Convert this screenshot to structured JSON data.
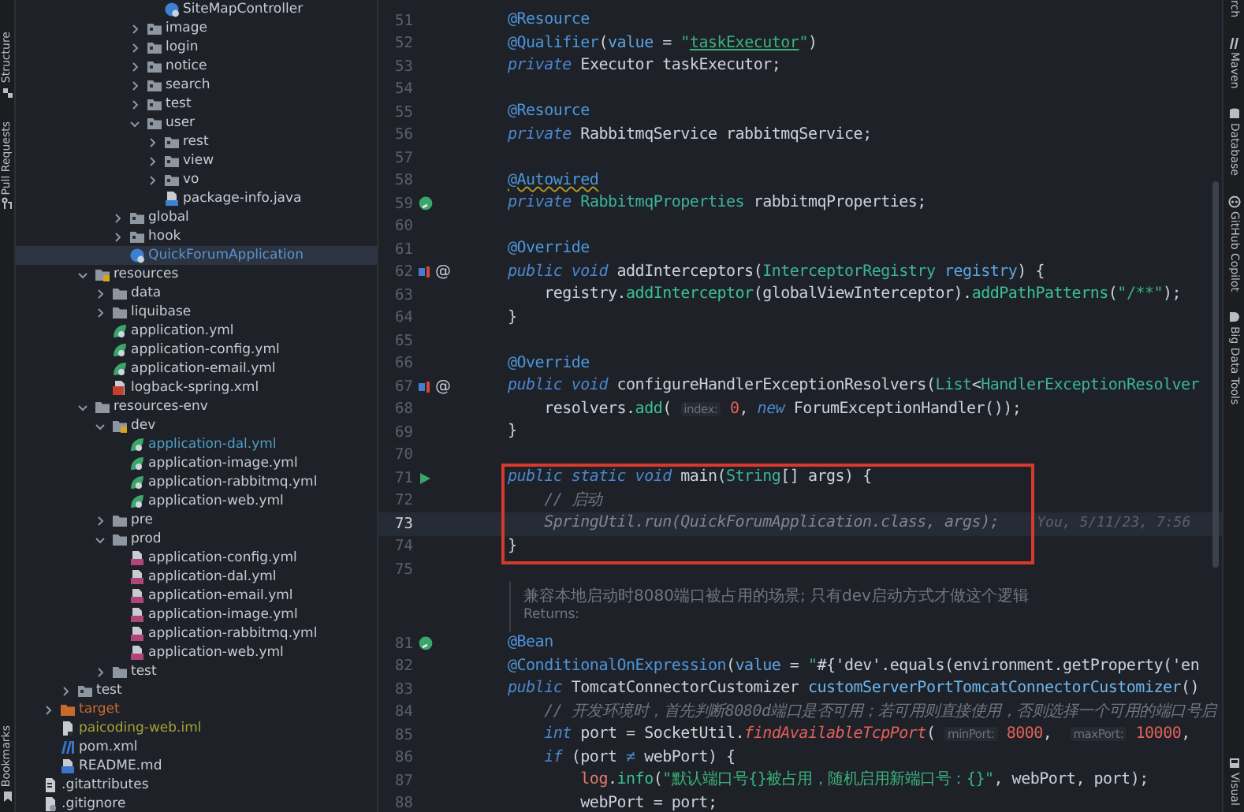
{
  "left_toolbar": {
    "top": [
      {
        "label": "Structure",
        "kind": "structure"
      },
      {
        "label": "Pull Requests",
        "kind": "pull-request"
      }
    ],
    "bottom": [
      {
        "label": "Bookmarks",
        "kind": "bookmark"
      }
    ]
  },
  "project_tree": [
    {
      "children": [
        {
          "children": [
            {
              "children": [
                {
                  "children": [
                    {
                      "children": [
                        {
                          "children": [
                            {
                              "children": [
                                {
                                  "label": "SiteMapController",
                                  "kind": "class",
                                  "selected": false
                                }
                              ]
                            },
                            {
                              "label": "image",
                              "kind": "folder",
                              "expanded": false,
                              "selected": false
                            },
                            {
                              "label": "login",
                              "kind": "folder",
                              "expanded": false,
                              "selected": false
                            },
                            {
                              "label": "notice",
                              "kind": "folder",
                              "expanded": false,
                              "selected": false
                            },
                            {
                              "label": "search",
                              "kind": "folder",
                              "expanded": false,
                              "selected": false
                            },
                            {
                              "label": "test",
                              "kind": "folder",
                              "expanded": false,
                              "selected": false
                            },
                            {
                              "label": "user",
                              "kind": "folder",
                              "expanded": true,
                              "selected": false,
                              "children": [
                                {
                                  "label": "rest",
                                  "kind": "folder",
                                  "expanded": false,
                                  "selected": false
                                },
                                {
                                  "label": "view",
                                  "kind": "folder",
                                  "expanded": false,
                                  "selected": false
                                },
                                {
                                  "label": "vo",
                                  "kind": "folder",
                                  "expanded": false,
                                  "selected": false
                                },
                                {
                                  "label": "package-info.java",
                                  "kind": "java-file",
                                  "selected": false
                                }
                              ]
                            }
                          ]
                        },
                        {
                          "label": "global",
                          "kind": "folder",
                          "expanded": false,
                          "selected": false
                        },
                        {
                          "label": "hook",
                          "kind": "folder",
                          "expanded": false,
                          "selected": false
                        },
                        {
                          "label": "QuickForumApplication",
                          "kind": "class",
                          "selected": true,
                          "color": "#5b93d0"
                        }
                      ]
                    }
                  ]
                },
                {
                  "label": "resources",
                  "kind": "resource-folder",
                  "expanded": true,
                  "selected": false,
                  "children": [
                    {
                      "label": "data",
                      "kind": "plain-folder",
                      "expanded": false,
                      "selected": false
                    },
                    {
                      "label": "liquibase",
                      "kind": "plain-folder",
                      "expanded": false,
                      "selected": false
                    },
                    {
                      "label": "application.yml",
                      "kind": "spring-yml",
                      "selected": false
                    },
                    {
                      "label": "application-config.yml",
                      "kind": "spring-yml",
                      "selected": false
                    },
                    {
                      "label": "application-email.yml",
                      "kind": "spring-yml",
                      "selected": false
                    },
                    {
                      "label": "logback-spring.xml",
                      "kind": "xml",
                      "selected": false
                    }
                  ]
                },
                {
                  "label": "resources-env",
                  "kind": "plain-folder",
                  "expanded": true,
                  "selected": false,
                  "children": [
                    {
                      "label": "dev",
                      "kind": "resource-folder",
                      "expanded": true,
                      "selected": false,
                      "children": [
                        {
                          "label": "application-dal.yml",
                          "kind": "spring-yml",
                          "selected": false,
                          "color": "#4d9ec9"
                        },
                        {
                          "label": "application-image.yml",
                          "kind": "spring-yml",
                          "selected": false
                        },
                        {
                          "label": "application-rabbitmq.yml",
                          "kind": "spring-yml",
                          "selected": false
                        },
                        {
                          "label": "application-web.yml",
                          "kind": "spring-yml",
                          "selected": false
                        }
                      ]
                    },
                    {
                      "label": "pre",
                      "kind": "plain-folder",
                      "expanded": false,
                      "selected": false
                    },
                    {
                      "label": "prod",
                      "kind": "plain-folder",
                      "expanded": true,
                      "selected": false,
                      "children": [
                        {
                          "label": "application-config.yml",
                          "kind": "yml",
                          "selected": false
                        },
                        {
                          "label": "application-dal.yml",
                          "kind": "yml",
                          "selected": false
                        },
                        {
                          "label": "application-email.yml",
                          "kind": "yml",
                          "selected": false
                        },
                        {
                          "label": "application-image.yml",
                          "kind": "yml",
                          "selected": false
                        },
                        {
                          "label": "application-rabbitmq.yml",
                          "kind": "yml",
                          "selected": false
                        },
                        {
                          "label": "application-web.yml",
                          "kind": "yml",
                          "selected": false
                        }
                      ]
                    },
                    {
                      "label": "test",
                      "kind": "plain-folder",
                      "expanded": false,
                      "selected": false
                    }
                  ]
                }
              ]
            },
            {
              "label": "test",
              "kind": "folder",
              "expanded": false,
              "selected": false
            }
          ]
        },
        {
          "label": "target",
          "kind": "excluded-folder",
          "expanded": false,
          "selected": false,
          "color": "#c9692e"
        },
        {
          "label": "paicoding-web.iml",
          "kind": "iml",
          "selected": false,
          "color": "#a3a332"
        },
        {
          "label": "pom.xml",
          "kind": "maven",
          "selected": false
        },
        {
          "label": "README.md",
          "kind": "markdown",
          "selected": false
        }
      ]
    },
    {
      "label": ".gitattributes",
      "kind": "text-file",
      "selected": false
    },
    {
      "label": ".gitignore",
      "kind": "git-file",
      "selected": false
    }
  ],
  "editor": {
    "blocks": [
      {
        "kind": "code",
        "lines": [
          {
            "number": "51",
            "current": false,
            "tokens": [
              {
                "kind": "annotation",
                "text": "@Resource"
              }
            ]
          },
          {
            "number": "52",
            "current": false,
            "tokens": [
              {
                "kind": "annotation",
                "text": "@Qualifier"
              },
              {
                "kind": "plain",
                "text": "("
              },
              {
                "kind": "param",
                "text": "value"
              },
              {
                "kind": "plain",
                "text": " = "
              },
              {
                "kind": "string",
                "text": "\""
              },
              {
                "kind": "string-link",
                "text": "taskExecutor"
              },
              {
                "kind": "string",
                "text": "\""
              },
              {
                "kind": "plain",
                "text": ")"
              }
            ]
          },
          {
            "number": "53",
            "current": false,
            "tokens": [
              {
                "kind": "keyword",
                "text": "private"
              },
              {
                "kind": "plain",
                "text": " Executor taskExecutor;"
              }
            ]
          },
          {
            "number": "54",
            "current": false
          },
          {
            "number": "55",
            "current": false,
            "tokens": [
              {
                "kind": "annotation",
                "text": "@Resource"
              }
            ]
          },
          {
            "number": "56",
            "current": false,
            "tokens": [
              {
                "kind": "keyword",
                "text": "private"
              },
              {
                "kind": "plain",
                "text": " RabbitmqService rabbitmqService;"
              }
            ]
          },
          {
            "number": "57",
            "current": false
          },
          {
            "number": "58",
            "current": false,
            "tokens": [
              {
                "kind": "annotation-warning",
                "text": "@Autowired"
              }
            ]
          },
          {
            "number": "59",
            "current": false,
            "gutter": {
              "kind": "bean"
            },
            "tokens": [
              {
                "kind": "keyword",
                "text": "private"
              },
              {
                "kind": "class",
                "text": " RabbitmqProperties"
              },
              {
                "kind": "plain",
                "text": " rabbitmqProperties;"
              }
            ]
          },
          {
            "number": "60",
            "current": false
          },
          {
            "number": "61",
            "current": false,
            "tokens": [
              {
                "kind": "annotation",
                "text": "@Override"
              }
            ]
          },
          {
            "number": "62",
            "current": false,
            "gutter": {
              "kind": "override",
              "text": "@"
            },
            "tokens": [
              {
                "kind": "keyword",
                "text": "public"
              },
              {
                "kind": "keyword",
                "text": " void"
              },
              {
                "kind": "plain",
                "text": " addInterceptors("
              },
              {
                "kind": "class",
                "text": "InterceptorRegistry"
              },
              {
                "kind": "param",
                "text": " registry"
              },
              {
                "kind": "plain",
                "text": ") {"
              }
            ]
          },
          {
            "number": "63",
            "current": false,
            "tokens": [
              {
                "kind": "plain",
                "text": "    registry."
              },
              {
                "kind": "method",
                "text": "addInterceptor"
              },
              {
                "kind": "plain",
                "text": "(globalViewInterceptor)."
              },
              {
                "kind": "method",
                "text": "addPathPatterns"
              },
              {
                "kind": "plain",
                "text": "("
              },
              {
                "kind": "string",
                "text": "\"/**\""
              },
              {
                "kind": "plain",
                "text": ");"
              }
            ]
          },
          {
            "number": "64",
            "current": false,
            "tokens": [
              {
                "kind": "plain",
                "text": "}"
              }
            ]
          },
          {
            "number": "65",
            "current": false
          },
          {
            "number": "66",
            "current": false,
            "tokens": [
              {
                "kind": "annotation",
                "text": "@Override"
              }
            ]
          },
          {
            "number": "67",
            "current": false,
            "gutter": {
              "kind": "override",
              "text": "@"
            },
            "tokens": [
              {
                "kind": "keyword",
                "text": "public"
              },
              {
                "kind": "keyword",
                "text": " void"
              },
              {
                "kind": "plain",
                "text": " configureHandlerExceptionResolvers("
              },
              {
                "kind": "class",
                "text": "List"
              },
              {
                "kind": "plain",
                "text": "<"
              },
              {
                "kind": "class",
                "text": "HandlerExceptionResolver"
              }
            ]
          },
          {
            "number": "68",
            "current": false,
            "tokens": [
              {
                "kind": "plain",
                "text": "    resolvers."
              },
              {
                "kind": "method",
                "text": "add"
              },
              {
                "kind": "plain",
                "text": "( "
              },
              {
                "kind": "hint",
                "text": "index:"
              },
              {
                "kind": "number",
                "text": " 0"
              },
              {
                "kind": "plain",
                "text": ", "
              },
              {
                "kind": "keyword",
                "text": "new"
              },
              {
                "kind": "plain",
                "text": " ForumExceptionHandler());"
              }
            ]
          },
          {
            "number": "69",
            "current": false,
            "tokens": [
              {
                "kind": "plain",
                "text": "}"
              }
            ]
          },
          {
            "number": "70",
            "current": false
          }
        ]
      },
      {
        "kind": "framed",
        "lines": [
          {
            "number": "71",
            "current": false,
            "gutter": {
              "kind": "run"
            },
            "tokens": [
              {
                "kind": "keyword",
                "text": "public"
              },
              {
                "kind": "keyword",
                "text": " static"
              },
              {
                "kind": "keyword",
                "text": " void"
              },
              {
                "kind": "plain",
                "text": " main("
              },
              {
                "kind": "class",
                "text": "String"
              },
              {
                "kind": "plain",
                "text": "[] args) {"
              }
            ]
          },
          {
            "number": "72",
            "current": false,
            "tokens": [
              {
                "kind": "comment",
                "text": "    // 启动"
              }
            ]
          },
          {
            "number": "73",
            "current": true,
            "blame": "You, 5/11/23, 7:56",
            "tokens": [
              {
                "kind": "unused",
                "text": "    SpringUtil.run(QuickForumApplication.class, args);"
              }
            ]
          },
          {
            "number": "74",
            "current": false,
            "tokens": [
              {
                "kind": "plain",
                "text": "}"
              }
            ]
          }
        ]
      },
      {
        "kind": "code",
        "lines": [
          {
            "number": "75",
            "current": false
          }
        ]
      },
      {
        "kind": "doc",
        "texts": [
          "兼容本地启动时8080端口被占用的场景; 只有dev启动方式才做这个逻辑",
          "Returns:"
        ]
      },
      {
        "kind": "code",
        "lines": [
          {
            "number": "81",
            "current": false,
            "gutter": {
              "kind": "bean"
            },
            "tokens": [
              {
                "kind": "annotation",
                "text": "@Bean"
              }
            ]
          },
          {
            "number": "82",
            "current": false,
            "tokens": [
              {
                "kind": "annotation",
                "text": "@ConditionalOnExpression"
              },
              {
                "kind": "plain",
                "text": "("
              },
              {
                "kind": "param",
                "text": "value"
              },
              {
                "kind": "plain",
                "text": " = "
              },
              {
                "kind": "string",
                "text": "\""
              },
              {
                "kind": "plain",
                "text": "#{'dev'.equals(environment.getProperty('en"
              }
            ]
          },
          {
            "number": "83",
            "current": false,
            "tokens": [
              {
                "kind": "keyword",
                "text": "public"
              },
              {
                "kind": "plain",
                "text": " TomcatConnectorCustomizer "
              },
              {
                "kind": "declaration",
                "text": "customServerPortTomcatConnectorCustomizer"
              },
              {
                "kind": "plain",
                "text": "()"
              }
            ]
          },
          {
            "number": "84",
            "current": false,
            "tokens": [
              {
                "kind": "comment",
                "text": "    // 开发环境时，首先判断8080d端口是否可用；若可用则直接使用，否则选择一个可用的端口号启"
              }
            ]
          },
          {
            "number": "85",
            "current": false,
            "tokens": [
              {
                "kind": "keyword",
                "text": "    int"
              },
              {
                "kind": "plain",
                "text": " port = SocketUtil."
              },
              {
                "kind": "static-method",
                "text": "findAvailableTcpPort"
              },
              {
                "kind": "plain",
                "text": "( "
              },
              {
                "kind": "hint",
                "text": "minPort:"
              },
              {
                "kind": "number",
                "text": " 8000"
              },
              {
                "kind": "plain",
                "text": ",  "
              },
              {
                "kind": "hint",
                "text": "maxPort:"
              },
              {
                "kind": "number",
                "text": " 10000"
              },
              {
                "kind": "plain",
                "text": ","
              }
            ]
          },
          {
            "number": "86",
            "current": false,
            "tokens": [
              {
                "kind": "keyword",
                "text": "    if"
              },
              {
                "kind": "plain",
                "text": " (port "
              },
              {
                "kind": "operator",
                "text": "≠"
              },
              {
                "kind": "plain",
                "text": " webPort) {"
              }
            ]
          },
          {
            "number": "87",
            "current": false,
            "tokens": [
              {
                "kind": "field",
                "text": "        log"
              },
              {
                "kind": "plain",
                "text": "."
              },
              {
                "kind": "method",
                "text": "info"
              },
              {
                "kind": "plain",
                "text": "("
              },
              {
                "kind": "string",
                "text": "\"默认端口号{}被占用，随机启用新端口号：{}\""
              },
              {
                "kind": "plain",
                "text": ", webPort, port);"
              }
            ]
          },
          {
            "number": "88",
            "current": false,
            "tokens": [
              {
                "kind": "plain",
                "text": "        webPort = port;"
              }
            ]
          }
        ]
      }
    ]
  },
  "right_toolbar": {
    "top": [
      {
        "label": "rch"
      },
      {
        "label": "Maven",
        "kind": "maven"
      },
      {
        "label": "Database",
        "kind": "database"
      },
      {
        "label": "GitHub Copilot",
        "kind": "copilot"
      },
      {
        "label": "Big Data Tools",
        "kind": "big-data"
      }
    ],
    "bottom": [
      {
        "label": "Visual",
        "kind": "panel"
      }
    ]
  }
}
